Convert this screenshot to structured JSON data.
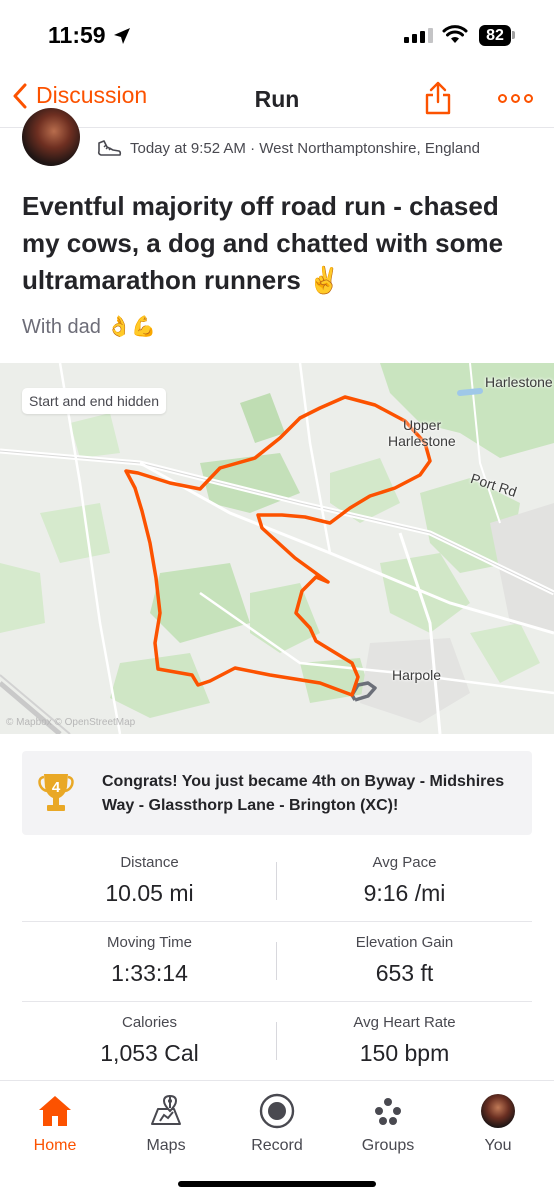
{
  "status_bar": {
    "time": "11:59",
    "battery": "82"
  },
  "nav": {
    "back_label": "Discussion",
    "title": "Run",
    "accent_color": "#fc5200"
  },
  "activity": {
    "meta": "Today at 9:52 AM · West Northamptonshire, England",
    "title": "Eventful majority off road run - chased my cows, a dog and chatted with some ultramarathon runners ✌️",
    "description": "With dad 👌💪"
  },
  "map": {
    "badge": "Start and end hidden",
    "places": {
      "harlestone": "Harlestone",
      "upper_1": "Upper",
      "upper_2": "Harlestone",
      "port_rd": "Port Rd",
      "harpole": "Harpole"
    },
    "attribution": "© Mapbox © OpenStreetMap",
    "route_color": "#fc5200"
  },
  "achievement": {
    "rank": "4",
    "text": "Congrats! You just became 4th on Byway - Midshires Way - Glassthorp Lane - Brington (XC)!"
  },
  "stats": [
    [
      {
        "label": "Distance",
        "value": "10.05 mi"
      },
      {
        "label": "Avg Pace",
        "value": "9:16 /mi"
      }
    ],
    [
      {
        "label": "Moving Time",
        "value": "1:33:14"
      },
      {
        "label": "Elevation Gain",
        "value": "653 ft"
      }
    ],
    [
      {
        "label": "Calories",
        "value": "1,053 Cal"
      },
      {
        "label": "Avg Heart Rate",
        "value": "150 bpm"
      }
    ]
  ],
  "tabs": [
    {
      "label": "Home",
      "icon": "home-icon",
      "active": true
    },
    {
      "label": "Maps",
      "icon": "map-icon"
    },
    {
      "label": "Record",
      "icon": "record-icon"
    },
    {
      "label": "Groups",
      "icon": "groups-icon"
    },
    {
      "label": "You",
      "icon": "avatar"
    }
  ]
}
